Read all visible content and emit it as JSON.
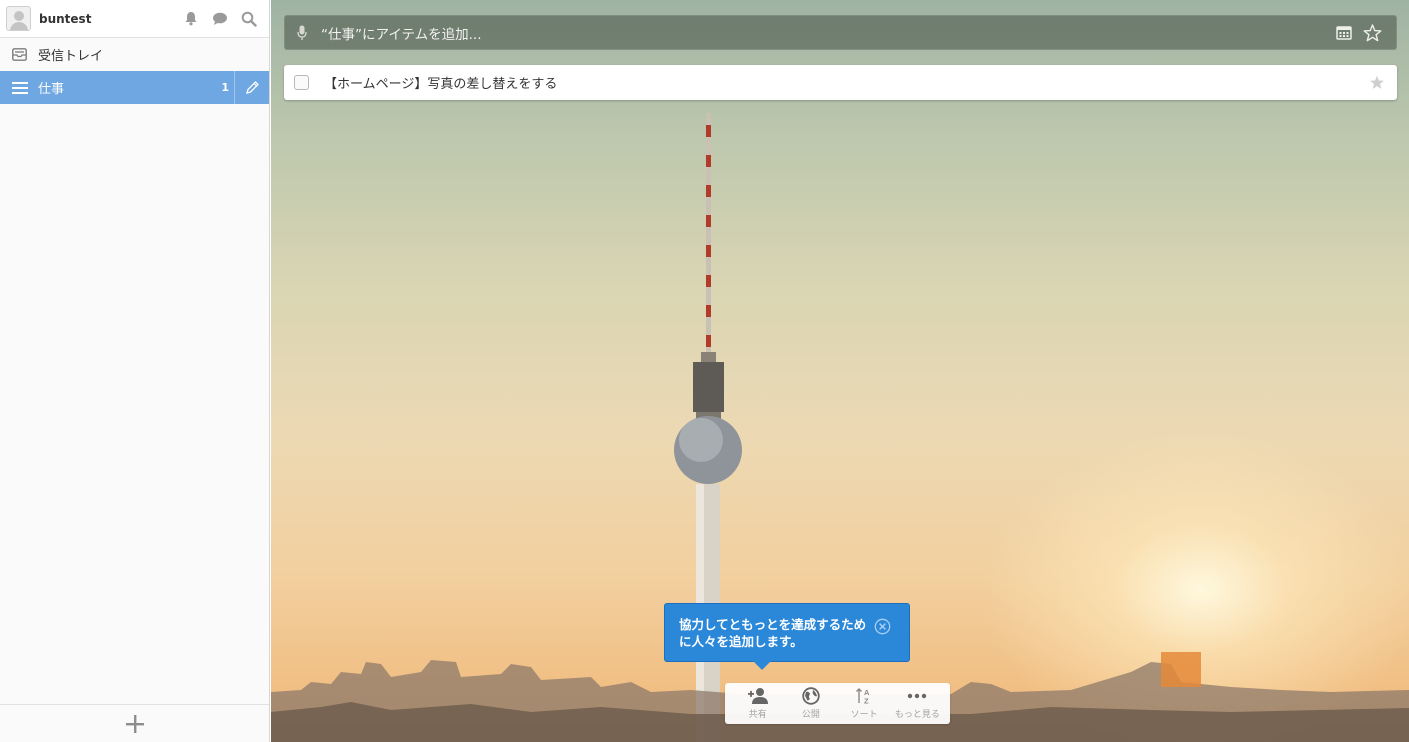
{
  "sidebar": {
    "username": "buntest",
    "items": [
      {
        "label": "受信トレイ",
        "icon": "inbox-icon"
      },
      {
        "label": "仕事",
        "icon": "list-icon",
        "count": "1",
        "active": true
      }
    ]
  },
  "add_bar": {
    "placeholder": "“仕事”にアイテムを追加..."
  },
  "tasks": [
    {
      "title": "【ホームページ】写真の差し替えをする",
      "completed": false,
      "starred": false
    }
  ],
  "tooltip": {
    "text": "協力してともっとを達成するために人々を追加します。"
  },
  "toolbar": {
    "share_label": "共有",
    "publish_label": "公開",
    "sort_label": "ソート",
    "more_label": "もっと見る"
  },
  "colors": {
    "accent": "#6fa7e2",
    "tooltip": "#2b88d9"
  }
}
